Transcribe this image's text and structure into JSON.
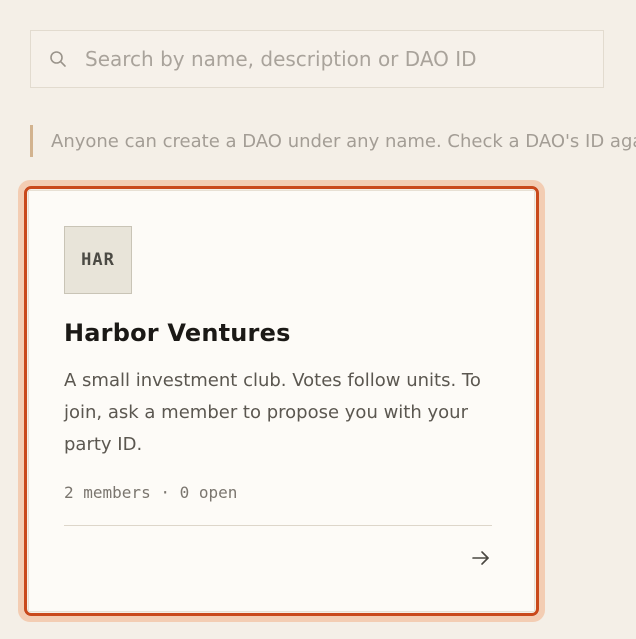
{
  "search": {
    "placeholder": "Search by name, description or DAO ID",
    "value": "",
    "icon": "search-icon"
  },
  "notice": {
    "text": "Anyone can create a DAO under any name. Check a DAO's ID against"
  },
  "dao_card": {
    "avatar_text": "HAR",
    "name": "Harbor Ventures",
    "description": "A small investment club. Votes follow units. To join, ask a member to propose you with your party ID.",
    "meta": "2 members · 0 open",
    "arrow_icon": "arrow-right-icon"
  },
  "colors": {
    "background": "#f4efe7",
    "card_background": "#fdfbf7",
    "focus_outline": "#c9491b",
    "focus_glow": "#f3cdb3",
    "notice_bar": "#d2b38f"
  }
}
